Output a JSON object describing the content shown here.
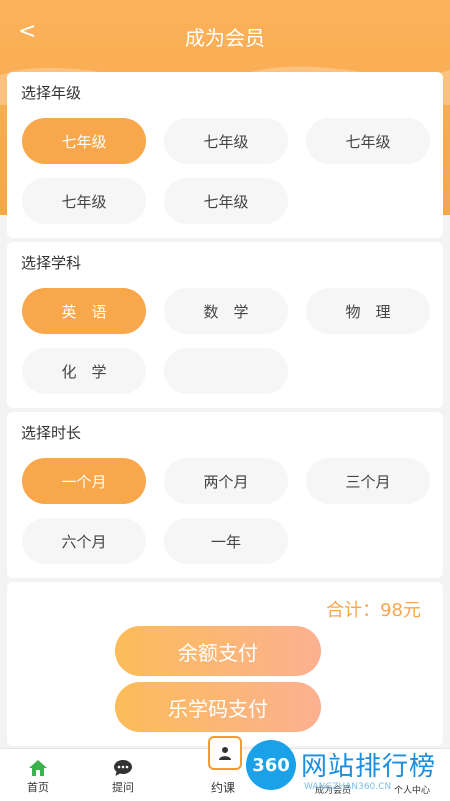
{
  "header": {
    "back_icon": "chevron-left-icon",
    "back": "<",
    "title": "成为会员"
  },
  "grade": {
    "title": "选择年级",
    "options": [
      {
        "label": "七年级",
        "active": true
      },
      {
        "label": "七年级",
        "active": false
      },
      {
        "label": "七年级",
        "active": false
      },
      {
        "label": "七年级",
        "active": false
      },
      {
        "label": "七年级",
        "active": false
      }
    ]
  },
  "subject": {
    "title": "选择学科",
    "options": [
      {
        "label": "英　语",
        "active": true
      },
      {
        "label": "数　学",
        "active": false
      },
      {
        "label": "物　理",
        "active": false
      },
      {
        "label": "化　学",
        "active": false
      },
      {
        "label": "",
        "active": false
      }
    ]
  },
  "duration": {
    "title": "选择时长",
    "options": [
      {
        "label": "一个月",
        "active": true
      },
      {
        "label": "两个月",
        "active": false
      },
      {
        "label": "三个月",
        "active": false
      },
      {
        "label": "六个月",
        "active": false
      },
      {
        "label": "一年",
        "active": false
      }
    ]
  },
  "payment": {
    "total": "合计：98元",
    "balance_pay": "余额支付",
    "code_pay": "乐学码支付"
  },
  "nav": {
    "items": [
      {
        "label": "首页",
        "icon": "home-icon"
      },
      {
        "label": "提问",
        "icon": "chat-icon"
      },
      {
        "label": "约课",
        "icon": "user-card-icon"
      },
      {
        "label": "成为会员",
        "icon": "member-icon"
      },
      {
        "label": "个人中心",
        "icon": "profile-icon"
      }
    ]
  },
  "watermark": {
    "badge": "360",
    "text": "网站排行榜",
    "sub": "WANGZHAN360.CN"
  },
  "colors": {
    "accent": "#f9a74b",
    "pill_bg": "#f6f6f6"
  }
}
